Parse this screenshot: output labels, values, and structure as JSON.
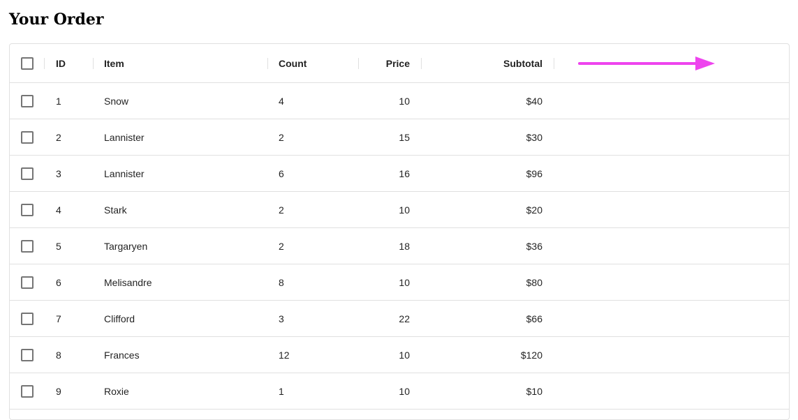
{
  "title": "Your Order",
  "columns": {
    "id": "ID",
    "item": "Item",
    "count": "Count",
    "price": "Price",
    "subtotal": "Subtotal"
  },
  "rows": [
    {
      "id": "1",
      "item": "Snow",
      "count": "4",
      "price": "10",
      "subtotal": "$40"
    },
    {
      "id": "2",
      "item": "Lannister",
      "count": "2",
      "price": "15",
      "subtotal": "$30"
    },
    {
      "id": "3",
      "item": "Lannister",
      "count": "6",
      "price": "16",
      "subtotal": "$96"
    },
    {
      "id": "4",
      "item": "Stark",
      "count": "2",
      "price": "10",
      "subtotal": "$20"
    },
    {
      "id": "5",
      "item": "Targaryen",
      "count": "2",
      "price": "18",
      "subtotal": "$36"
    },
    {
      "id": "6",
      "item": "Melisandre",
      "count": "8",
      "price": "10",
      "subtotal": "$80"
    },
    {
      "id": "7",
      "item": "Clifford",
      "count": "3",
      "price": "22",
      "subtotal": "$66"
    },
    {
      "id": "8",
      "item": "Frances",
      "count": "12",
      "price": "10",
      "subtotal": "$120"
    },
    {
      "id": "9",
      "item": "Roxie",
      "count": "1",
      "price": "10",
      "subtotal": "$10"
    }
  ],
  "annotation": {
    "icon": "arrow-right-icon",
    "color": "#ee44ee"
  }
}
